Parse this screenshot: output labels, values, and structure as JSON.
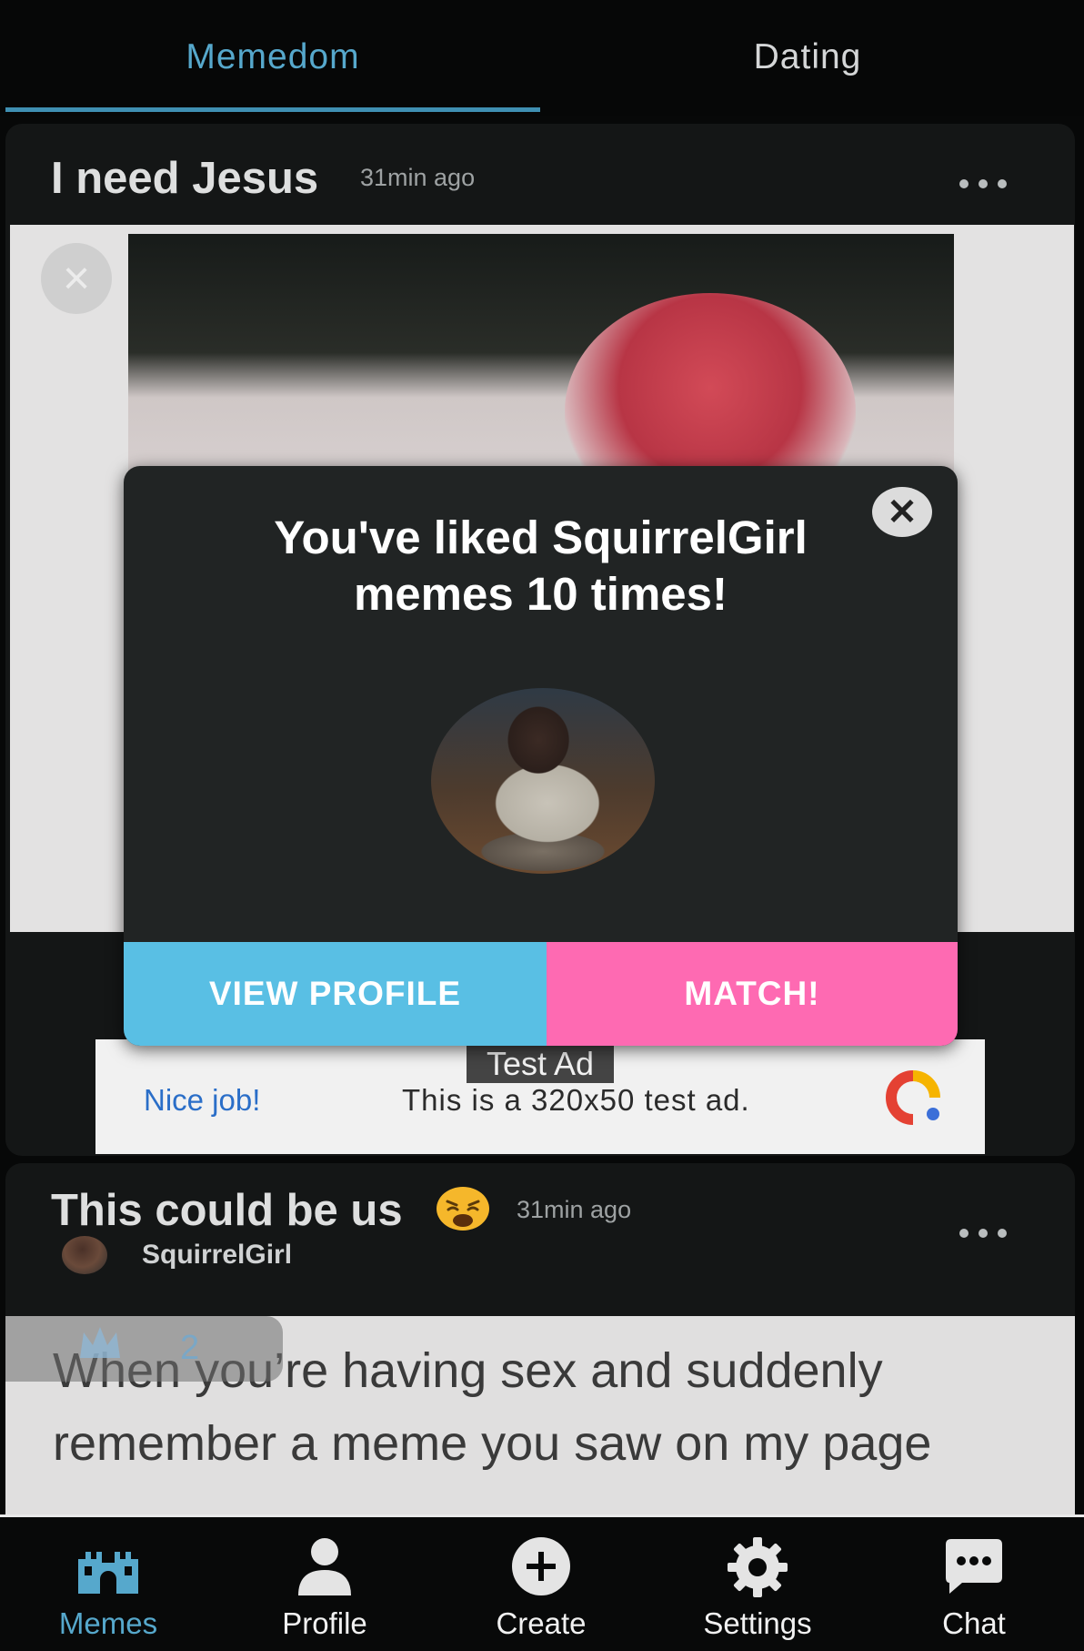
{
  "tabs": [
    {
      "label": "Memedom",
      "active": true
    },
    {
      "label": "Dating",
      "active": false
    }
  ],
  "colors": {
    "accent": "#56a8cc",
    "view_profile": "#59bfe4",
    "match": "#fe6ab2",
    "background": "#070808",
    "card": "#141616",
    "modal": "#212424"
  },
  "post1": {
    "title": "I need Jesus",
    "time": "31min ago",
    "menu_icon": "more-dots-icon"
  },
  "modal": {
    "title_line1": "You've liked SquirrelGirl",
    "title_line2": "memes 10 times!",
    "close_icon": "close-icon",
    "view_profile": "VIEW PROFILE",
    "match": "MATCH!"
  },
  "ad": {
    "tag": "Test Ad",
    "nice": "Nice job!",
    "text": "This is a 320x50 test ad."
  },
  "post2": {
    "title": "This could be us",
    "emoji": "weary-face-emoji",
    "time": "31min ago",
    "author": "SquirrelGirl",
    "meme_text": "When you’re having sex and suddenly remember a meme you saw on my page",
    "likes": "2",
    "like_icon": "crown-icon"
  },
  "nav": [
    {
      "label": "Memes",
      "icon": "castle-icon",
      "active": true
    },
    {
      "label": "Profile",
      "icon": "user-icon",
      "active": false
    },
    {
      "label": "Create",
      "icon": "plus-circle-icon",
      "active": false
    },
    {
      "label": "Settings",
      "icon": "gear-icon",
      "active": false
    },
    {
      "label": "Chat",
      "icon": "chat-bubble-icon",
      "active": false
    }
  ]
}
